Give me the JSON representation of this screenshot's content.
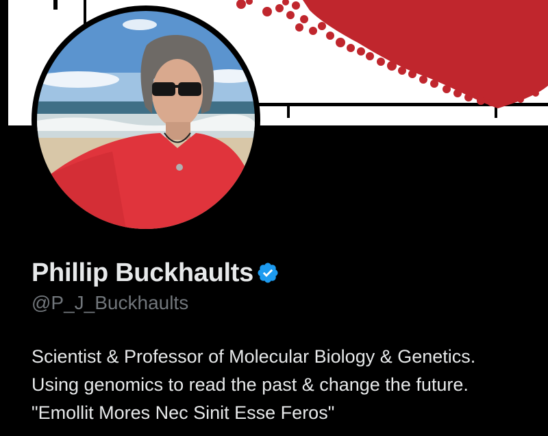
{
  "profile": {
    "display_name": "Phillip Buckhaults",
    "handle": "@P_J_Buckhaults",
    "verified": true,
    "bio_lines": [
      "Scientist & Professor of Molecular Biology & Genetics.",
      "Using genomics to read the past & change the future.",
      "\"Emollit Mores Nec Sinit Esse Feros\""
    ]
  },
  "icons": {
    "verified": "verified-badge-icon"
  },
  "colors": {
    "background": "#000000",
    "name": "#e7e9ea",
    "handle": "#71767b",
    "verified_badge": "#1d9bf0",
    "banner_red": "#c0262d"
  }
}
